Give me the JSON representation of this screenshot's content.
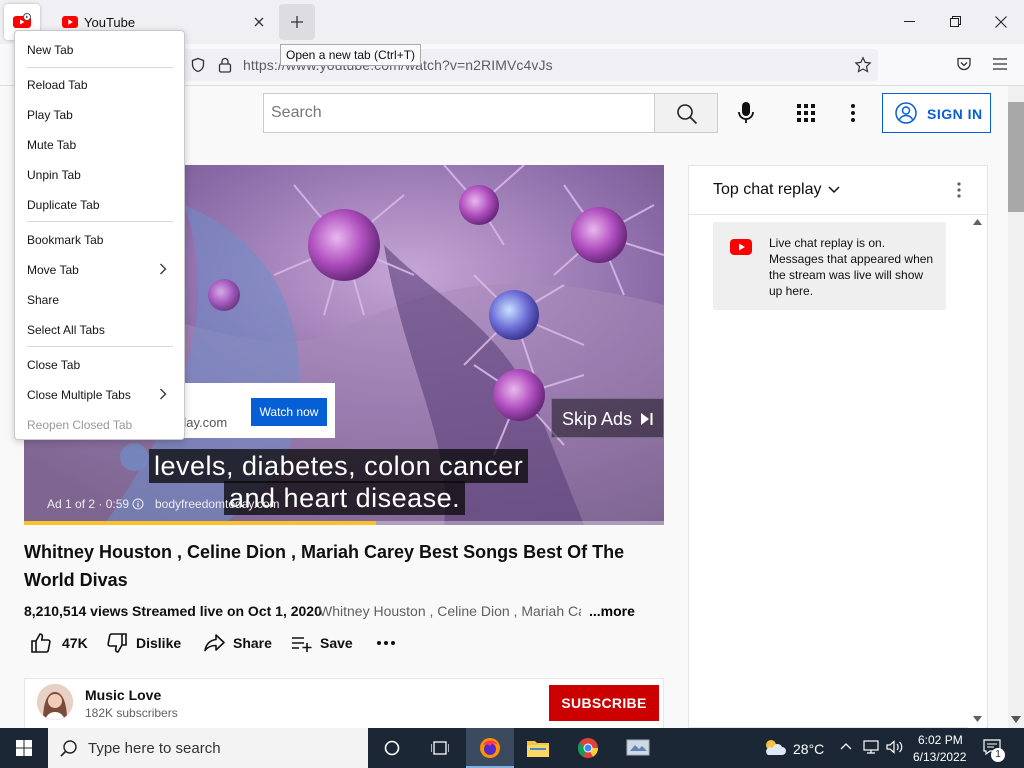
{
  "browser": {
    "tab_title": "YouTube",
    "tooltip": "Open a new tab (Ctrl+T)",
    "url": "https://www.youtube.com/watch?v=n2RIMVc4vJs"
  },
  "context_menu": {
    "items": [
      {
        "label": "New Tab",
        "disabled": false
      },
      {
        "label": "Reload Tab",
        "disabled": false
      },
      {
        "label": "Play Tab",
        "disabled": false
      },
      {
        "label": "Mute Tab",
        "disabled": false
      },
      {
        "label": "Unpin Tab",
        "disabled": false
      },
      {
        "label": "Duplicate Tab",
        "disabled": false
      },
      {
        "label": "Bookmark Tab",
        "disabled": false
      },
      {
        "label": "Move Tab",
        "disabled": false,
        "submenu": true
      },
      {
        "label": "Share",
        "disabled": false
      },
      {
        "label": "Select All Tabs",
        "disabled": false
      },
      {
        "label": "Close Tab",
        "disabled": false
      },
      {
        "label": "Close Multiple Tabs",
        "disabled": false,
        "submenu": true
      },
      {
        "label": "Reopen Closed Tab",
        "disabled": true
      }
    ]
  },
  "youtube": {
    "search_placeholder": "Search",
    "signin_label": "SIGN IN"
  },
  "player": {
    "ad_domain": "day.com",
    "watch_now": "Watch now",
    "skip_ads": "Skip Ads",
    "caption_line1": "levels, diabetes, colon cancer",
    "caption_line2": "and heart disease.",
    "ad_info": "Ad 1 of 2 · 0:59",
    "ad_url": "bodyfreedomtoday.com",
    "ad_progress_fraction": 0.55
  },
  "video": {
    "title": "Whitney Houston , Celine Dion , Mariah Carey Best Songs Best Of The World Divas",
    "views": "8,210,514 views",
    "streamed": "Streamed live on Oct 1, 2020",
    "description_snippet": "Whitney Houston , Celine Dion , Mariah Ca...",
    "more_label": "...more",
    "likes": "47K",
    "dislike_label": "Dislike",
    "share_label": "Share",
    "save_label": "Save"
  },
  "channel": {
    "name": "Music Love",
    "subscribers": "182K subscribers",
    "subscribe_label": "SUBSCRIBE"
  },
  "chat": {
    "title": "Top chat replay",
    "notice": "Live chat replay is on. Messages that appeared when the stream was live will show up here."
  },
  "taskbar": {
    "search_placeholder": "Type here to search",
    "temperature": "28°C",
    "time": "6:02 PM",
    "date": "6/13/2022",
    "notification_count": "1"
  },
  "colors": {
    "youtube_red": "#ff0000",
    "link_blue": "#065fd4",
    "subscribe_red": "#cc0000",
    "ad_progress_yellow": "#fbc02d",
    "taskbar": "#1c2735"
  },
  "icons": [
    "youtube-icon",
    "close-icon",
    "plus-icon",
    "minimize-icon",
    "restore-icon",
    "shield-icon",
    "lock-icon",
    "star-icon",
    "pocket-icon",
    "hamburger-icon",
    "search-icon",
    "mic-icon",
    "apps-grid-icon",
    "more-vert-icon",
    "user-icon",
    "thumb-up-icon",
    "thumb-down-icon",
    "share-icon",
    "playlist-add-icon",
    "more-horiz-icon",
    "chevron-down-icon",
    "chevron-right-icon",
    "skip-icon",
    "windows-icon",
    "task-view-icon",
    "firefox-icon",
    "folder-icon",
    "chrome-icon",
    "app-icon",
    "weather-icon",
    "network-icon",
    "volume-icon",
    "notification-icon"
  ]
}
